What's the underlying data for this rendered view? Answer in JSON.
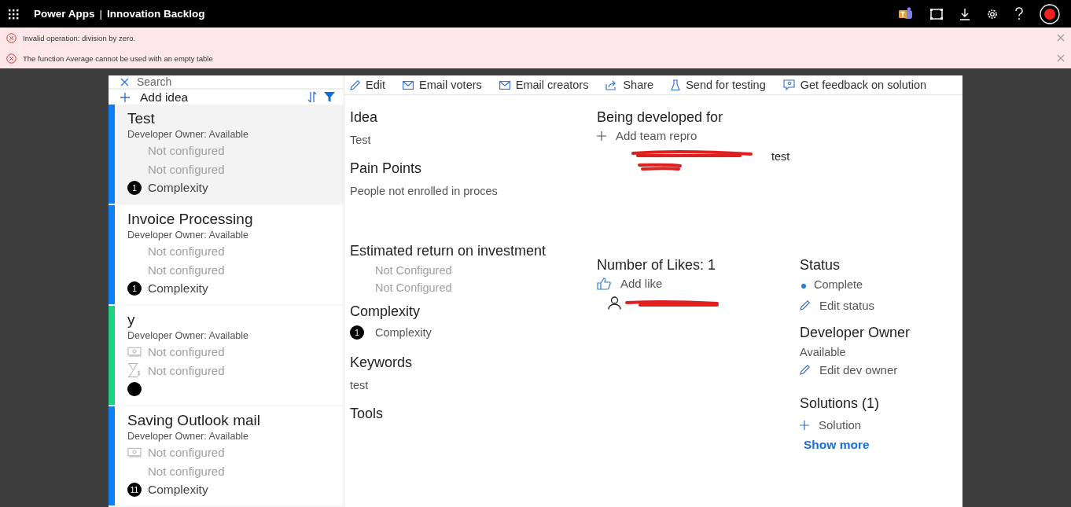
{
  "topbar": {
    "app": "Power Apps",
    "separator": "|",
    "title": "Innovation Backlog"
  },
  "errors": [
    {
      "message": "Invalid operation: division by zero."
    },
    {
      "message": "The function Average cannot be used with an empty table"
    }
  ],
  "search": {
    "placeholder": "Search"
  },
  "add_idea": "Add idea",
  "ideas": [
    {
      "title": "Test",
      "owner": "Developer Owner: Available",
      "color": "#0f7ff5",
      "selected": true,
      "lines": [
        {
          "text": "Not configured",
          "kind": "plain"
        },
        {
          "text": "Not configured",
          "kind": "plain"
        }
      ],
      "badge": "1",
      "complexity": "Complexity"
    },
    {
      "title": "Invoice Processing",
      "owner": "Developer Owner: Available",
      "color": "#0f7ff5",
      "selected": false,
      "lines": [
        {
          "text": "Not configured",
          "kind": "plain"
        },
        {
          "text": "Not configured",
          "kind": "plain"
        }
      ],
      "badge": "1",
      "complexity": "Complexity"
    },
    {
      "title": "y",
      "owner": "Developer Owner: Available",
      "color": "#1ed37f",
      "selected": false,
      "lines": [
        {
          "text": "Not configured",
          "kind": "money"
        },
        {
          "text": "Not configured",
          "kind": "time"
        }
      ]
    },
    {
      "title": "Saving Outlook mail",
      "owner": "Developer Owner: Available",
      "color": "#0f7ff5",
      "selected": false,
      "lines": [
        {
          "text": "Not configured",
          "kind": "money"
        },
        {
          "text": "Not configured",
          "kind": "plain"
        }
      ],
      "badge": "11",
      "complexity": "Complexity"
    }
  ],
  "toolbar": [
    "Edit",
    "Email voters",
    "Email creators",
    "Share",
    "Send for testing",
    "Get feedback on solution"
  ],
  "idea": {
    "heading": "Idea",
    "value": "Test"
  },
  "pain_points": {
    "heading": "Pain Points",
    "value": "People not enrolled in proces"
  },
  "roi": {
    "heading": "Estimated return on investment",
    "values": [
      "Not Configured",
      "Not Configured"
    ]
  },
  "complexity": {
    "heading": "Complexity",
    "badge": "1",
    "label": "Complexity"
  },
  "keywords": {
    "heading": "Keywords",
    "value": "test"
  },
  "tools": {
    "heading": "Tools"
  },
  "developed_for": {
    "heading": "Being developed for",
    "add": "Add team repro",
    "team_note": "test"
  },
  "likes": {
    "heading": "Number of Likes: 1",
    "add": "Add like"
  },
  "status": {
    "heading": "Status",
    "value": "Complete",
    "edit": "Edit status"
  },
  "developer_owner": {
    "heading": "Developer Owner",
    "value": "Available",
    "edit": "Edit dev owner"
  },
  "solutions": {
    "heading": "Solutions (1)",
    "add": "Solution",
    "more": "Show more"
  }
}
